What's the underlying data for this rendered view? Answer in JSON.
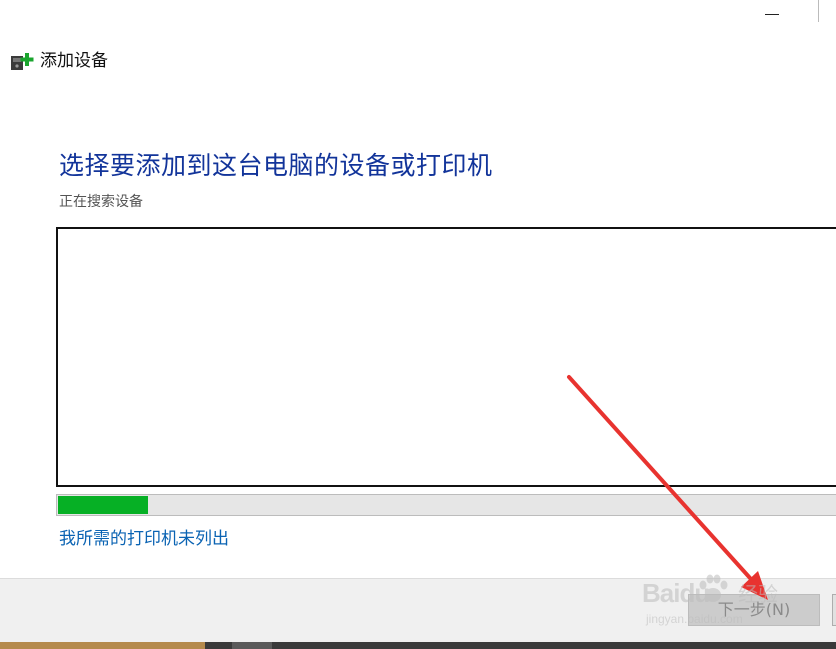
{
  "dialog": {
    "title": "添加设备",
    "heading": "选择要添加到这台电脑的设备或打印机",
    "status": "正在搜索设备",
    "progress_fraction": 0.115,
    "printer_link": "我所需的打印机未列出",
    "next_button": "下一步(N)"
  },
  "watermark": {
    "brand": "Baidu",
    "product": "经验",
    "url": "jingyan.baidu.com"
  },
  "colors": {
    "heading": "#12349a",
    "link": "#0a63b3",
    "progress_fill": "#06b025",
    "annotation_arrow": "#e8332f"
  },
  "icons": {
    "app": "add-device-icon",
    "minimize": "minimize-icon"
  }
}
